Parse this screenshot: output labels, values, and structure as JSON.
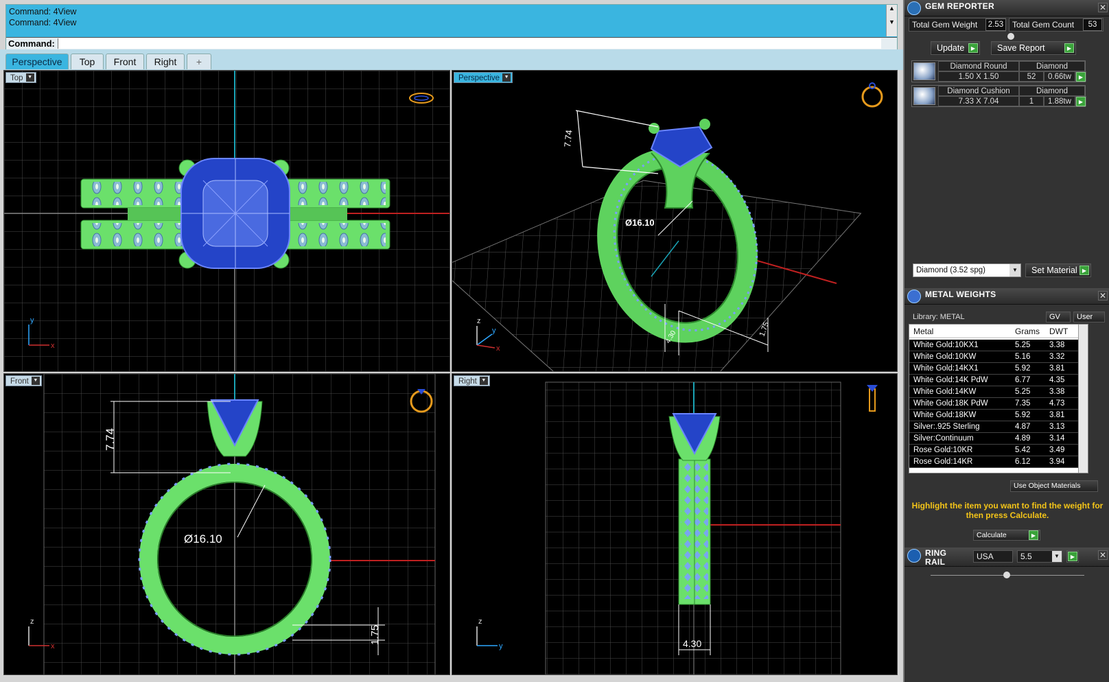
{
  "command": {
    "history": [
      "Command: 4View",
      "Command: 4View"
    ],
    "prompt_label": "Command:"
  },
  "tabs": [
    {
      "label": "Perspective",
      "active": true
    },
    {
      "label": "Top",
      "active": false
    },
    {
      "label": "Front",
      "active": false
    },
    {
      "label": "Right",
      "active": false
    },
    {
      "label": "+",
      "active": false
    }
  ],
  "viewports": {
    "top": {
      "label": "Top",
      "axes": [
        "y",
        "x"
      ]
    },
    "perspective": {
      "label": "Perspective",
      "dim_height": "7.74",
      "dim_diameter": "Ø16.10",
      "dim_band": "1.75",
      "dim_small": "4.30",
      "axes": [
        "z",
        "y",
        "x"
      ]
    },
    "front": {
      "label": "Front",
      "dim_height": "7.74",
      "dim_diameter": "Ø16.10",
      "dim_band": "1.75",
      "axes": [
        "z",
        "x"
      ]
    },
    "right": {
      "label": "Right",
      "dim_width": "4.30",
      "axes": [
        "z",
        "y"
      ]
    }
  },
  "gem_reporter": {
    "title": "GEM REPORTER",
    "total_weight_label": "Total Gem Weight",
    "total_weight_value": "2.53",
    "total_count_label": "Total Gem Count",
    "total_count_value": "53",
    "update_label": "Update",
    "save_report_label": "Save Report",
    "gems": [
      {
        "name": "Diamond Round",
        "size": "1.50 X 1.50",
        "material": "Diamond",
        "count": "52",
        "weight": "0.66tw"
      },
      {
        "name": "Diamond Cushion",
        "size": "7.33 X 7.04",
        "material": "Diamond",
        "count": "1",
        "weight": "1.88tw"
      }
    ],
    "material_select": "Diamond      (3.52 spg)",
    "set_material_label": "Set Material"
  },
  "metal_weights": {
    "title": "METAL WEIGHTS",
    "library_label": "Library: METAL",
    "gv_label": "GV",
    "user_label": "User",
    "columns": [
      "Metal",
      "Grams",
      "DWT"
    ],
    "rows": [
      [
        "White Gold:10KX1",
        "5.25",
        "3.38"
      ],
      [
        "White Gold:10KW",
        "5.16",
        "3.32"
      ],
      [
        "White Gold:14KX1",
        "5.92",
        "3.81"
      ],
      [
        "White Gold:14K PdW",
        "6.77",
        "4.35"
      ],
      [
        "White Gold:14KW",
        "5.25",
        "3.38"
      ],
      [
        "White Gold:18K PdW",
        "7.35",
        "4.73"
      ],
      [
        "White Gold:18KW",
        "5.92",
        "3.81"
      ],
      [
        "Silver:.925 Sterling",
        "4.87",
        "3.13"
      ],
      [
        "Silver:Continuum",
        "4.89",
        "3.14"
      ],
      [
        "Rose Gold:10KR",
        "5.42",
        "3.49"
      ],
      [
        "Rose Gold:14KR",
        "6.12",
        "3.94"
      ]
    ],
    "use_object_materials_label": "Use Object Materials",
    "note": "Highlight the item you want to find the weight for then press Calculate.",
    "calculate_label": "Calculate"
  },
  "ring_rail": {
    "title": "RING RAIL",
    "region": "USA",
    "size": "5.5"
  },
  "colors": {
    "accent": "#3ab5e0",
    "metal_green": "#6be06b",
    "gem_blue": "#2444c8",
    "go_green": "#3aa33a",
    "note_yellow": "#f5c518"
  }
}
